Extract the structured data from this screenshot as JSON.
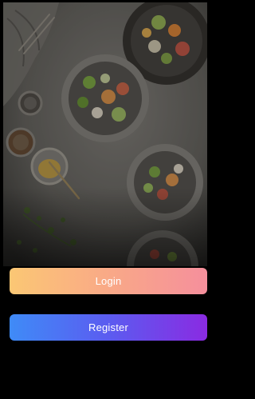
{
  "hero": {
    "image_subject": "overhead-photo-of-salad-plates-on-table"
  },
  "actions": {
    "login_label": "Login",
    "register_label": "Register"
  },
  "colors": {
    "background": "#000000",
    "login_gradient": [
      "#fbc774",
      "#f9a987",
      "#f58f9c"
    ],
    "register_gradient": [
      "#3f8bf7",
      "#5b5cf0",
      "#8a2be2"
    ],
    "button_text": "#ffffff"
  }
}
